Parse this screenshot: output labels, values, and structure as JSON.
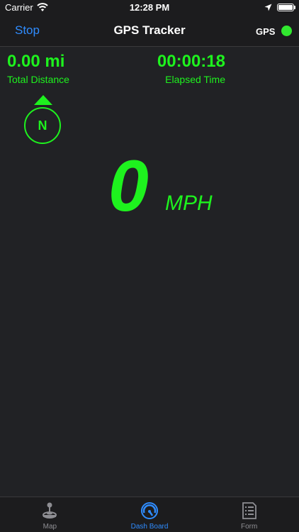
{
  "status_bar": {
    "carrier": "Carrier",
    "time": "12:28 PM"
  },
  "nav": {
    "left_button": "Stop",
    "title": "GPS Tracker",
    "gps_label": "GPS",
    "gps_status_color": "#31e82f"
  },
  "dashboard": {
    "distance_value": "0.00 mi",
    "distance_label": "Total Distance",
    "elapsed_value": "00:00:18",
    "elapsed_label": "Elapsed Time",
    "heading": "N",
    "speed_value": "0",
    "speed_unit": "MPH",
    "accent_color": "#1ef21e"
  },
  "tabs": [
    {
      "label": "Map",
      "icon": "joystick-icon",
      "active": false
    },
    {
      "label": "Dash Board",
      "icon": "speedometer-icon",
      "active": true
    },
    {
      "label": "Form",
      "icon": "form-document-icon",
      "active": false
    }
  ]
}
